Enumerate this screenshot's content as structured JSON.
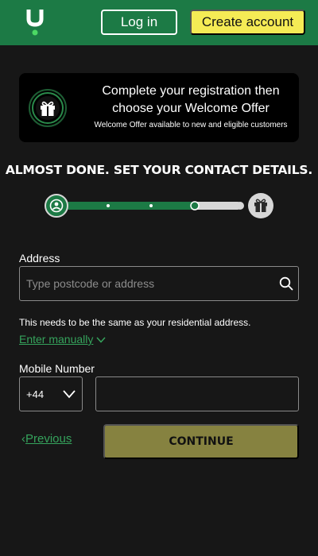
{
  "header": {
    "logo_icon": "unibet-u-logo",
    "login_label": "Log in",
    "create_label": "Create account",
    "brand_green": "#1c7a45",
    "create_yellow": "#f5eb55"
  },
  "promo": {
    "icon": "gift-icon",
    "title": "Complete your registration then choose your Welcome Offer",
    "subtitle": "Welcome Offer available to new and eligible customers"
  },
  "steps": {
    "heading": "ALMOST DONE. SET YOUR CONTACT DETAILS.",
    "start_icon": "user-icon",
    "end_icon": "gift-icon",
    "progress": 0.75,
    "intermediate_steps": 3
  },
  "address": {
    "label": "Address",
    "placeholder": "Type postcode or address",
    "value": "",
    "search_icon": "search-icon",
    "hint": "This needs to be the same as your residential address.",
    "manual_label": "Enter manually"
  },
  "mobile": {
    "label": "Mobile Number",
    "country_code": "+44",
    "number": ""
  },
  "actions": {
    "previous_label": "Previous",
    "continue_label": "CONTINUE"
  }
}
